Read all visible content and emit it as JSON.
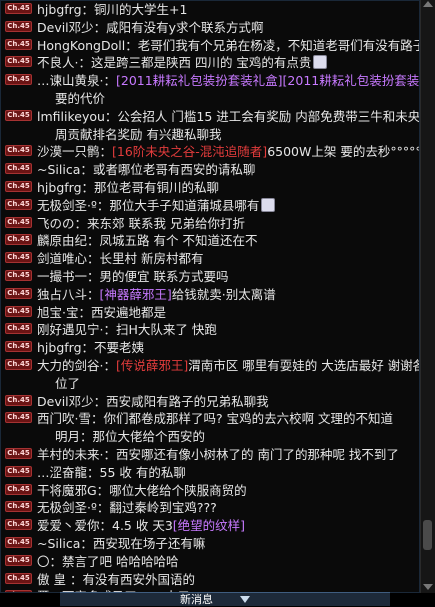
{
  "channel_tag": "Ch.45",
  "messages": [
    {
      "text": "hjbgfrg：铜川的大学生+1"
    },
    {
      "text": "Devil邓少：咸阳有没有y求个联系方式啊"
    },
    {
      "text": "HongKongDoll：老哥们我有个兄弟在杨凌，不知道老哥们有没有路子"
    },
    {
      "text": "不良人·：这是跨三都是陕西 四川的 宝鸡的有点贵",
      "emoji": true
    },
    {
      "prefix": "…谏山黄泉·：",
      "tag": "[2011耕耘礼包装扮套装礼盒][2011耕耘礼包装扮套装礼盒]",
      "cont": "要的代价"
    },
    {
      "text": "lmfilikeyou：公会招人 门槛15 进工会有奖励 内部免费带三牛和未央 每",
      "cont": "周贡献排名奖励 有兴趣私聊我"
    },
    {
      "prefix": "沙漠一只鹘：",
      "tag2": "[16阶未央之谷-混沌追随者]",
      "suffix": "6500W上架  要的去秒°°°°°°°°°°°"
    },
    {
      "text": "~Silica：或者哪位老哥有西安的请私聊"
    },
    {
      "text": "hjbgfrg：那位老哥有铜川的私聊"
    },
    {
      "text": "无极剑圣·º：那位大手子知道蒲城县哪有",
      "emoji": true
    },
    {
      "text": "飞のの：来东郊    联系我  兄弟给你打折"
    },
    {
      "text": "麟原由纪：凤城五路    有个  不知道还在不"
    },
    {
      "text": "剑道唯心：长里村 新房村都有"
    },
    {
      "text": "一撮书一：男的便宜  联系方式要吗"
    },
    {
      "prefix": "独占八斗：",
      "tag": "[神器薛邪王]",
      "suffix": "给钱就卖·别太离谱"
    },
    {
      "text": "旭宝·宝：西安遍地都是"
    },
    {
      "text": "刚好遇见宁·：扫H大队来了 快跑"
    },
    {
      "text": "hjbgfrg：不要老姨"
    },
    {
      "prefix": "大力的剑谷·：",
      "tag2": "[传说薛邪王]",
      "suffix": "渭南市区  哪里有耍娃的  大选店最好  谢谢各",
      "cont": "位了"
    },
    {
      "text": "Devil邓少：西安咸阳有路子的兄弟私聊我"
    },
    {
      "text": "西门吹·雪：你们都卷成那样了吗? 宝鸡的去六校啊  文理的不知道",
      "cont": "明月：那位大佬给个西安的"
    },
    {
      "text": "羊村的未来·：西安哪还有像小树林了的   南门了的那种呢    找不到了"
    },
    {
      "text": "…涩奋龍：55  收    有的私聊"
    },
    {
      "text": "干将魔邪G：哪位大佬给个陕服商贸的"
    },
    {
      "text": "无极剑圣·º：翻过秦岭到宝鸡???"
    },
    {
      "prefix": "爱爱丶爱你：4.5  收  天3",
      "tag": "[绝望的纹样]"
    },
    {
      "text": "~Silica：西安现在场子还有嘛"
    },
    {
      "text": "〇：禁言了吧 哈哈哈哈哈"
    },
    {
      "text": "傲 皇   ：有没有西安外国语的"
    },
    {
      "text": "璽：西安多成马了 498大元"
    }
  ],
  "new_message_label": "新消息"
}
